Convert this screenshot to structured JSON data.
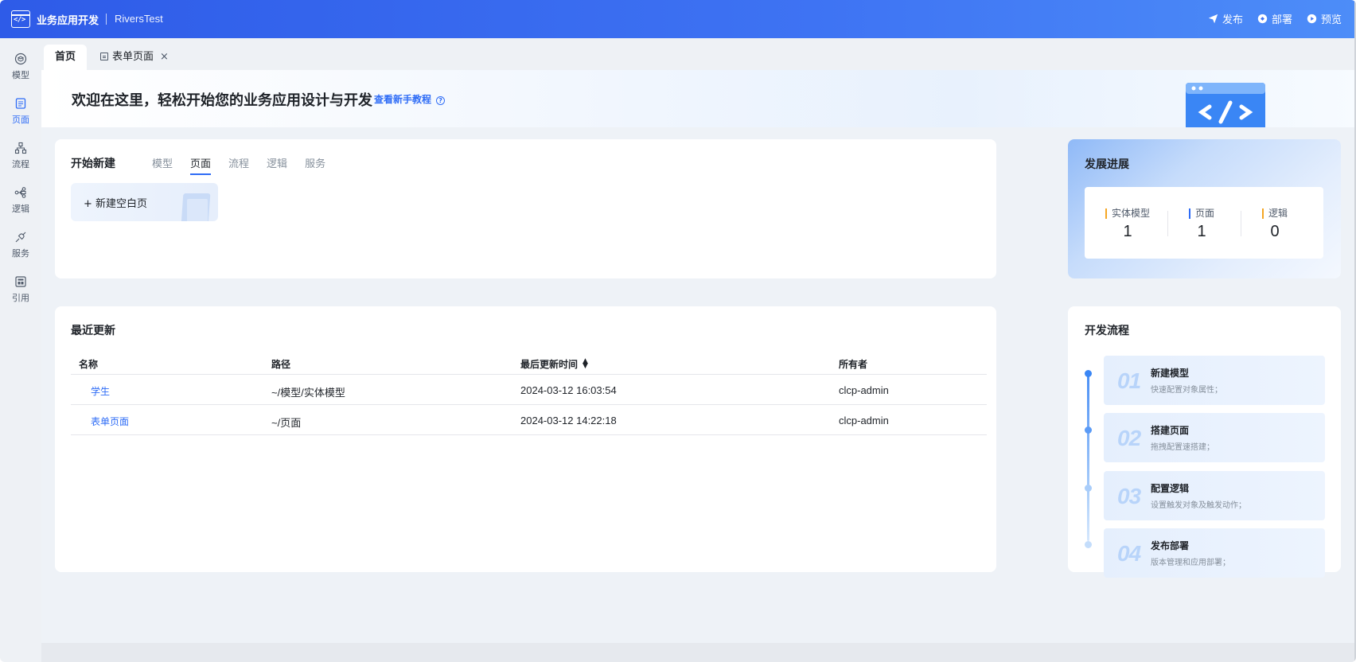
{
  "topbar": {
    "app_name": "业务应用开发",
    "project_name": "RiversTest",
    "actions": [
      {
        "label": "发布",
        "icon": "send-icon"
      },
      {
        "label": "部署",
        "icon": "deploy-icon"
      },
      {
        "label": "预览",
        "icon": "play-icon"
      }
    ]
  },
  "leftnav": {
    "items": [
      {
        "label": "模型",
        "icon": "model-icon",
        "active": false
      },
      {
        "label": "页面",
        "icon": "page-icon",
        "active": true
      },
      {
        "label": "流程",
        "icon": "flow-icon",
        "active": false
      },
      {
        "label": "逻辑",
        "icon": "logic-icon",
        "active": false
      },
      {
        "label": "服务",
        "icon": "service-icon",
        "active": false
      },
      {
        "label": "引用",
        "icon": "reference-icon",
        "active": false
      }
    ]
  },
  "tabs": [
    {
      "label": "首页",
      "active": true
    },
    {
      "label": "表单页面",
      "active": false,
      "closable": true
    }
  ],
  "banner": {
    "title": "欢迎在这里，轻松开始您的业务应用设计与开发",
    "link": "查看新手教程"
  },
  "create": {
    "title": "开始新建",
    "tabs": [
      "模型",
      "页面",
      "流程",
      "逻辑",
      "服务"
    ],
    "active_tab": "页面",
    "new_button": "新建空白页"
  },
  "progress": {
    "title": "发展进展",
    "stats": [
      {
        "name": "实体模型",
        "value": "1",
        "color": "#f5a623"
      },
      {
        "name": "页面",
        "value": "1",
        "color": "#2e6cf6"
      },
      {
        "name": "逻辑",
        "value": "0",
        "color": "#f5a623"
      }
    ]
  },
  "recent": {
    "title": "最近更新",
    "columns": [
      "名称",
      "路径",
      "最后更新时间",
      "所有者"
    ],
    "rows": [
      {
        "name": "学生",
        "path": "~/模型/实体模型",
        "updated": "2024-03-12 16:03:54",
        "owner": "clcp-admin"
      },
      {
        "name": "表单页面",
        "path": "~/页面",
        "updated": "2024-03-12 14:22:18",
        "owner": "clcp-admin"
      }
    ]
  },
  "flow": {
    "title": "开发流程",
    "steps": [
      {
        "num": "01",
        "title": "新建模型",
        "desc": "快速配置对象属性；"
      },
      {
        "num": "02",
        "title": "搭建页面",
        "desc": "拖拽配置速搭建；"
      },
      {
        "num": "03",
        "title": "配置逻辑",
        "desc": "设置触发对象及触发动作；"
      },
      {
        "num": "04",
        "title": "发布部署",
        "desc": "版本管理和应用部署；"
      }
    ]
  },
  "colors": {
    "primary": "#2e6cf6",
    "accent": "#f5a623",
    "topbar_start": "#2e5be8",
    "topbar_end": "#4d8df8"
  }
}
